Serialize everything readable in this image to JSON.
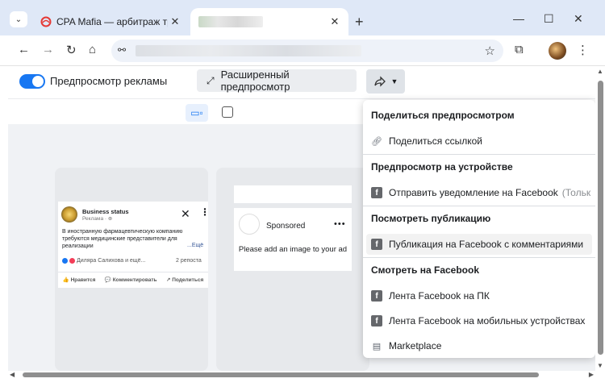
{
  "browser": {
    "tabs": [
      {
        "title": "CPA Mafia — арбитраж трафи",
        "close": "✕"
      },
      {
        "title": "",
        "close": "✕"
      }
    ],
    "new_tab": "+",
    "window_controls": {
      "minimize": "—",
      "maximize": "☐",
      "close": "✕"
    },
    "nav": {
      "back": "←",
      "forward": "→",
      "reload": "↻",
      "home": "⌂",
      "site_info": "⚯",
      "star": "☆",
      "extensions": "⧉",
      "menu": "⋮"
    }
  },
  "controls": {
    "preview_label": "Предпросмотр рекламы",
    "expanded_preview": "Расширенный предпросмотр"
  },
  "menu": {
    "share_header": "Поделиться предпросмотром",
    "share_link": "Поделиться ссылкой",
    "device_header": "Предпросмотр на устройстве",
    "send_notification": "Отправить уведомление на Facebook",
    "send_notification_suffix": "(Тольк",
    "view_header": "Посмотреть публикацию",
    "fb_post_comments": "Публикация на Facebook с комментариями",
    "watch_header": "Смотреть на Facebook",
    "feed_desktop": "Лента Facebook на ПК",
    "feed_mobile": "Лента Facebook на мобильных устройствах",
    "marketplace": "Marketplace"
  },
  "mobile_ad": {
    "page_name": "Business status",
    "sponsored": "Реклама · ⊕",
    "text": "В иностранную фармацевтическую компанию требуются медицинские представители для реализации",
    "more": "...Ещё",
    "reactions_text": "Диляра Салихова и ещё...",
    "reposts": "2 репоста",
    "like": "Нравится",
    "comment": "Комментировать",
    "share": "Поделиться"
  },
  "center_ad": {
    "sponsored": "Sponsored",
    "dots": "•••",
    "message": "Please add an image to your ad"
  },
  "colors": {
    "accent": "#1877f2",
    "titlebar": "#dfe8f7"
  }
}
